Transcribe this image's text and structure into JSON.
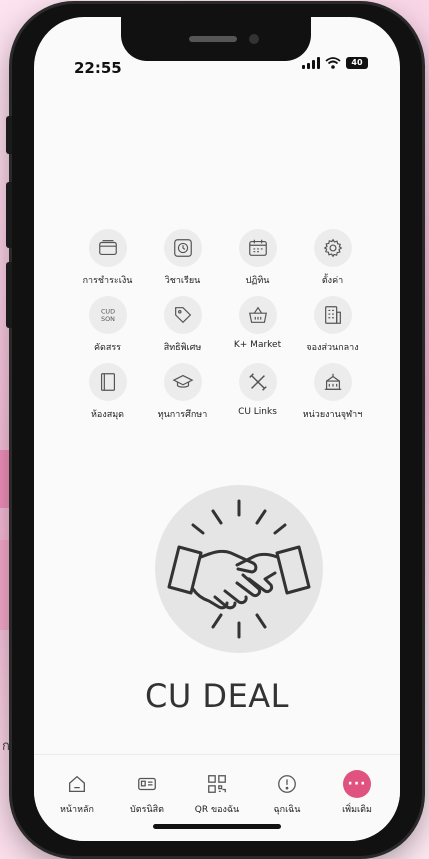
{
  "status_bar": {
    "time": "22:55",
    "battery": "40"
  },
  "side_text": "ก",
  "menu": [
    {
      "label": "การชำระเงิน",
      "icon": "wallet-icon"
    },
    {
      "label": "วิชาเรียน",
      "icon": "clock-icon"
    },
    {
      "label": "ปฏิทิน",
      "icon": "calendar-icon"
    },
    {
      "label": "ตั้งค่า",
      "icon": "gear-icon"
    },
    {
      "label": "คัดสรร",
      "icon": "cud-son-icon",
      "icon_text_top": "CUD",
      "icon_text_bottom": "SON"
    },
    {
      "label": "สิทธิพิเศษ",
      "icon": "tag-icon"
    },
    {
      "label": "K+ Market",
      "icon": "basket-icon"
    },
    {
      "label": "จองส่วนกลาง",
      "icon": "booking-icon"
    },
    {
      "label": "ห้องสมุด",
      "icon": "book-icon"
    },
    {
      "label": "ทุนการศึกษา",
      "icon": "graduation-cap-icon"
    },
    {
      "label": "CU Links",
      "icon": "tools-icon"
    },
    {
      "label": "หน่วยงานจุฬาฯ",
      "icon": "building-icon"
    }
  ],
  "feature": {
    "title": "CU DEAL",
    "icon": "handshake-icon"
  },
  "tabbar": [
    {
      "label": "หน้าหลัก",
      "icon": "home-icon"
    },
    {
      "label": "บัตรนิสิต",
      "icon": "id-card-icon"
    },
    {
      "label": "QR ของฉัน",
      "icon": "qr-code-icon"
    },
    {
      "label": "ฉุกเฉิน",
      "icon": "alert-icon"
    },
    {
      "label": "เพิ่มเติม",
      "icon": "more-icon",
      "glyph": "···"
    }
  ],
  "colors": {
    "accent": "#e0527f",
    "icon_bg": "#ececec",
    "deal_bg": "#e5e5e5",
    "text": "#222222"
  }
}
